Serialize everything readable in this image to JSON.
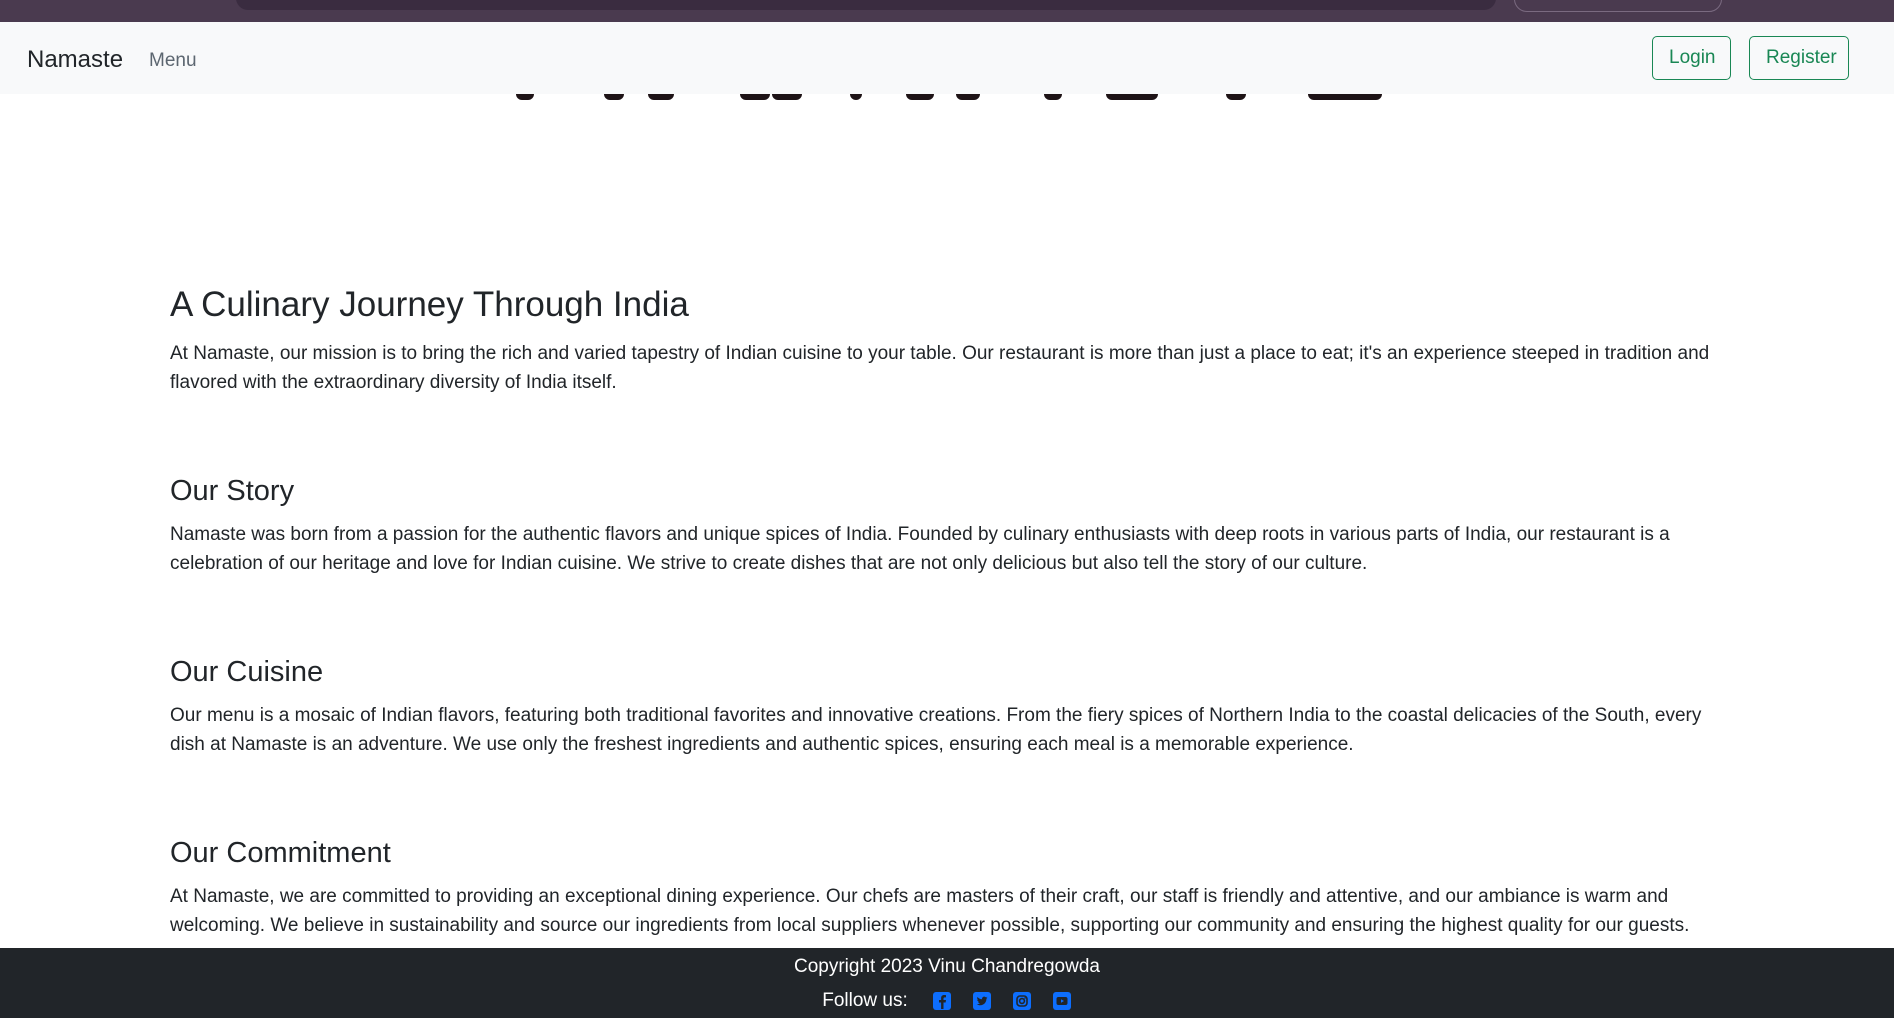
{
  "navbar": {
    "brand": "Namaste",
    "menu_label": "Menu",
    "login_label": "Login",
    "register_label": "Register"
  },
  "sections": [
    {
      "title": "A Culinary Journey Through India",
      "body": "At Namaste, our mission is to bring the rich and varied tapestry of Indian cuisine to your table. Our restaurant is more than just a place to eat; it's an experience steeped in tradition and flavored with the extraordinary diversity of India itself."
    },
    {
      "title": "Our Story",
      "body": "Namaste was born from a passion for the authentic flavors and unique spices of India. Founded by culinary enthusiasts with deep roots in various parts of India, our restaurant is a celebration of our heritage and love for Indian cuisine. We strive to create dishes that are not only delicious but also tell the story of our culture."
    },
    {
      "title": "Our Cuisine",
      "body": "Our menu is a mosaic of Indian flavors, featuring both traditional favorites and innovative creations. From the fiery spices of Northern India to the coastal delicacies of the South, every dish at Namaste is an adventure. We use only the freshest ingredients and authentic spices, ensuring each meal is a memorable experience."
    },
    {
      "title": "Our Commitment",
      "body": "At Namaste, we are committed to providing an exceptional dining experience. Our chefs are masters of their craft, our staff is friendly and attentive, and our ambiance is warm and welcoming. We believe in sustainability and source our ingredients from local suppliers whenever possible, supporting our community and ensuring the highest quality for our guests."
    }
  ],
  "footer": {
    "copyright": "Copyright 2023 Vinu Chandregowda",
    "follow_label": "Follow us:",
    "social_icons": [
      "facebook-icon",
      "twitter-icon",
      "instagram-icon",
      "youtube-icon"
    ]
  },
  "colors": {
    "navbar_bg": "#f8f9fa",
    "button_outline": "#198754",
    "footer_bg": "#212529",
    "social_icon": "#0d6efd"
  }
}
